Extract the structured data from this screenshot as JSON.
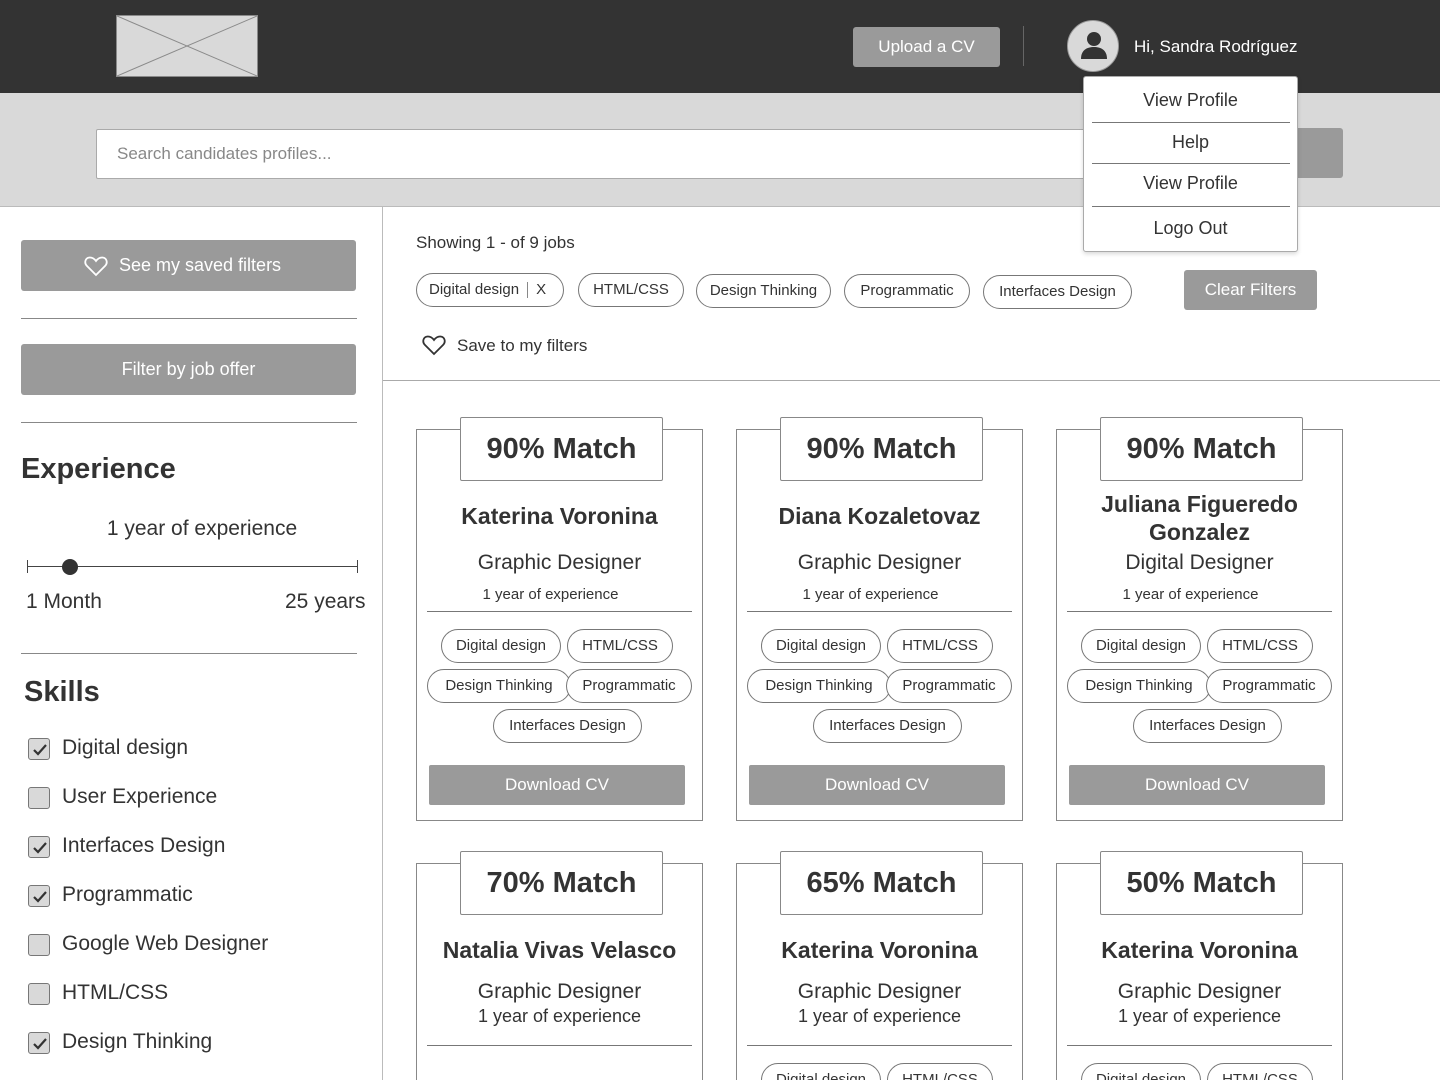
{
  "header": {
    "upload_label": "Upload a CV",
    "greeting": "Hi, Sandra Rodríguez"
  },
  "user_menu": {
    "items": [
      "View Profile",
      "Help",
      "View Profile",
      "Logo Out"
    ]
  },
  "search": {
    "placeholder": "Search candidates profiles..."
  },
  "sidebar": {
    "saved_filters_label": "See my saved filters",
    "filter_job_offer_label": "Filter by job offer",
    "experience": {
      "heading": "Experience",
      "value": "1 year of experience",
      "min_label": "1 Month",
      "max_label": "25 years",
      "slider_fraction": 0.13
    },
    "skills": {
      "heading": "Skills",
      "items": [
        {
          "label": "Digital design",
          "checked": true
        },
        {
          "label": "User Experience",
          "checked": false
        },
        {
          "label": "Interfaces Design",
          "checked": true
        },
        {
          "label": "Programmatic",
          "checked": true
        },
        {
          "label": "Google Web Designer",
          "checked": false
        },
        {
          "label": "HTML/CSS",
          "checked": false
        },
        {
          "label": "Design Thinking",
          "checked": true
        }
      ]
    }
  },
  "results": {
    "showing": "Showing 1 - of 9 jobs",
    "active_filters": [
      "Digital design",
      "HTML/CSS",
      "Design Thinking",
      "Programmatic",
      "Interfaces Design"
    ],
    "remove_mark": "X",
    "clear_label": "Clear Filters",
    "save_label": "Save to my filters"
  },
  "cards": [
    {
      "match": "90% Match",
      "name": "Katerina Voronina",
      "role": "Graphic Designer",
      "experience": "1 year of experience",
      "skills": [
        "Digital design",
        "HTML/CSS",
        "Design Thinking",
        "Programmatic",
        "Interfaces Design"
      ],
      "download": "Download CV"
    },
    {
      "match": "90% Match",
      "name": "Diana Kozaletovaz",
      "role": "Graphic Designer",
      "experience": "1 year of experience",
      "skills": [
        "Digital design",
        "HTML/CSS",
        "Design Thinking",
        "Programmatic",
        "Interfaces Design"
      ],
      "download": "Download CV"
    },
    {
      "match": "90% Match",
      "name": "Juliana Figueredo Gonzalez",
      "role": "Digital Designer",
      "experience": "1 year of experience",
      "skills": [
        "Digital design",
        "HTML/CSS",
        "Design Thinking",
        "Programmatic",
        "Interfaces Design"
      ],
      "download": "Download CV"
    },
    {
      "match": "70% Match",
      "name": "Natalia Vivas Velasco",
      "role": "Graphic Designer",
      "experience": "1 year of experience",
      "skills": []
    },
    {
      "match": "65% Match",
      "name": "Katerina Voronina",
      "role": "Graphic Designer",
      "experience": "1 year of experience",
      "skills": [
        "Digital design",
        "HTML/CSS"
      ]
    },
    {
      "match": "50% Match",
      "name": "Katerina Voronina",
      "role": "Graphic Designer",
      "experience": "1 year of experience",
      "skills": [
        "Digital design",
        "HTML/CSS"
      ]
    }
  ]
}
